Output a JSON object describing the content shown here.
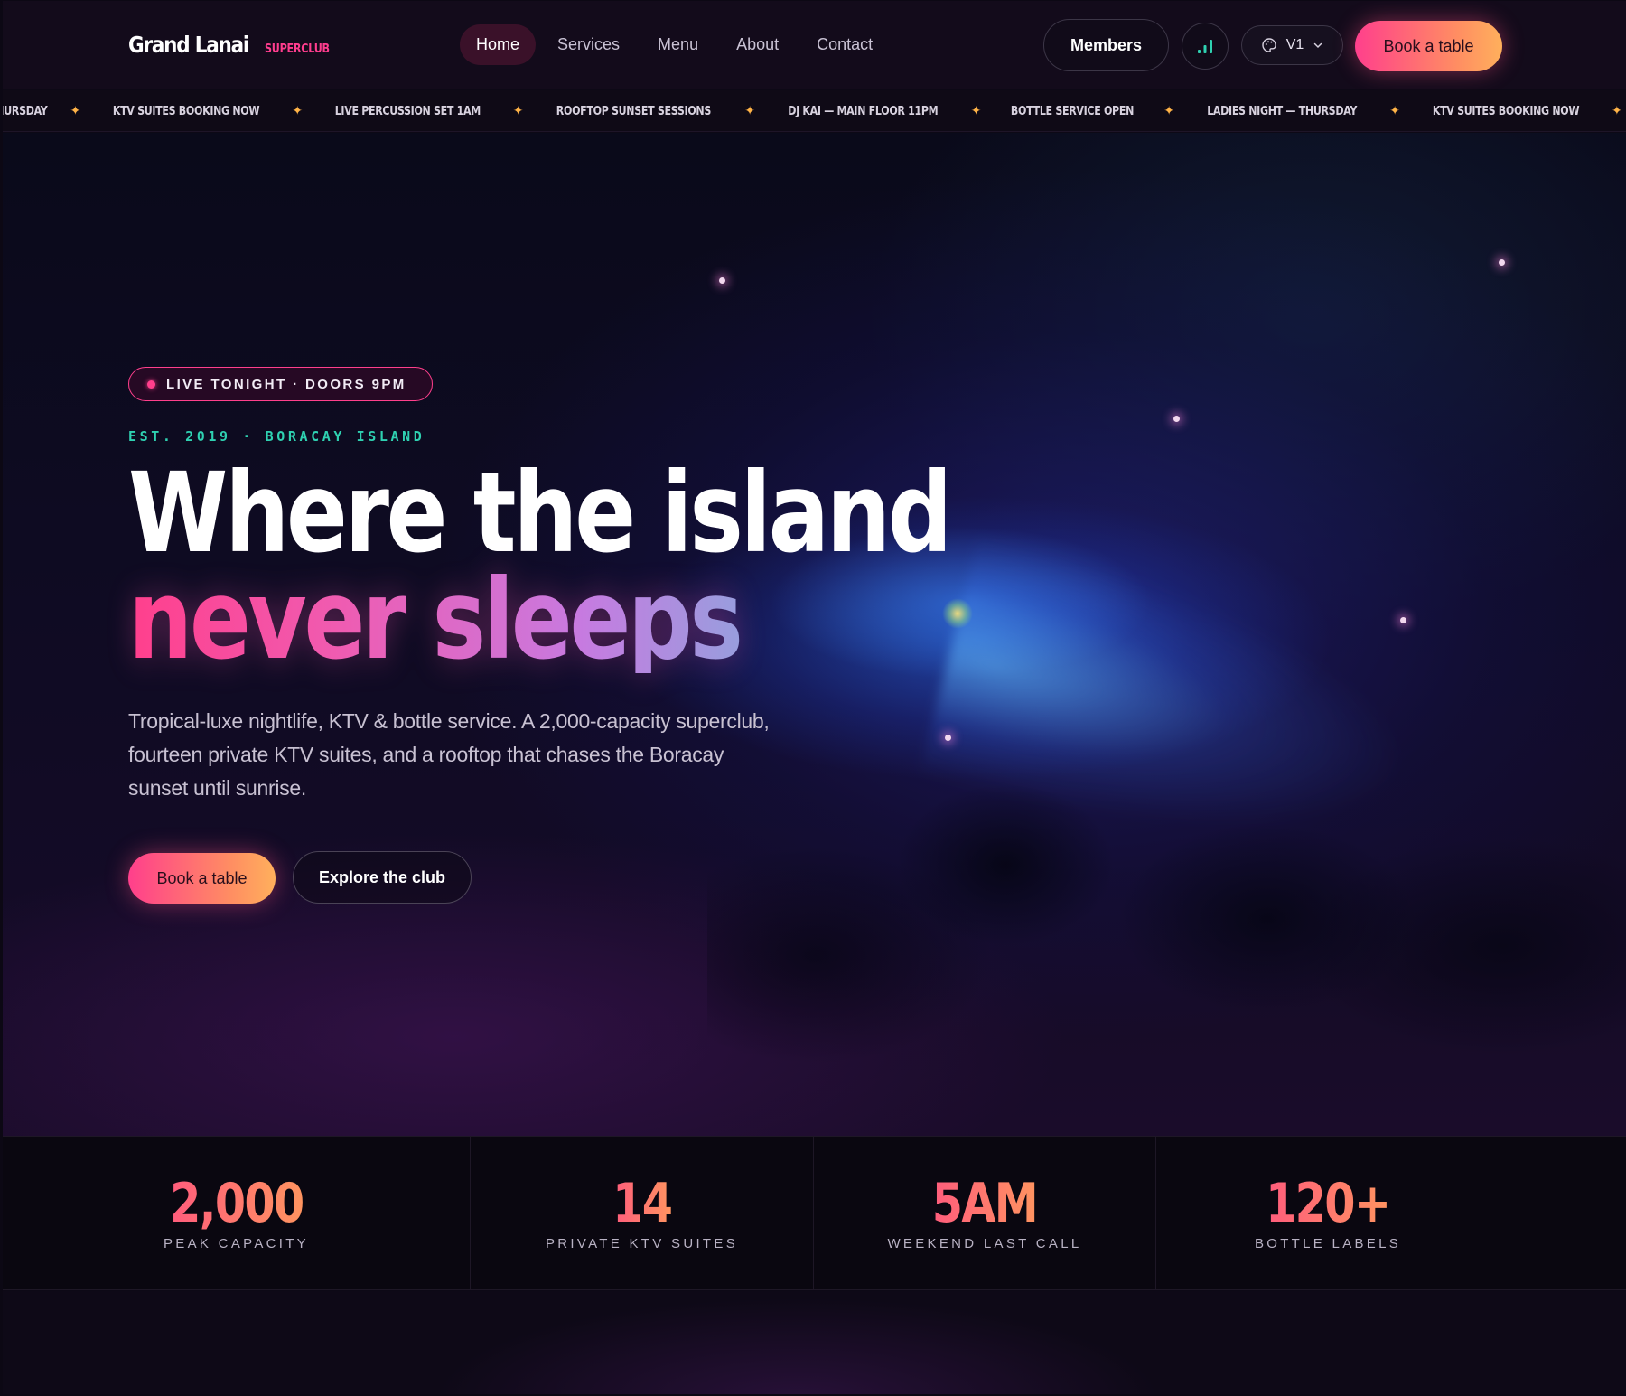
{
  "brand": {
    "name": "Grand Lanai",
    "tagline": "SUPERCLUB"
  },
  "nav": {
    "links": [
      "Home",
      "Services",
      "Menu",
      "About",
      "Contact"
    ],
    "active": "Home",
    "members_label": "Members",
    "theme_label": "V1",
    "book_label": "Book a table"
  },
  "ticker": {
    "items": [
      "THURSDAY",
      "KTV SUITES BOOKING NOW",
      "LIVE PERCUSSION SET 1AM",
      "ROOFTOP SUNSET SESSIONS",
      "DJ KAI — MAIN FLOOR 11PM",
      "BOTTLE SERVICE OPEN",
      "LADIES NIGHT — THURSDAY",
      "KTV SUITES BOOKING NOW"
    ],
    "separator": "✦"
  },
  "hero": {
    "badge": "LIVE TONIGHT · DOORS 9PM",
    "eyebrow": "EST. 2019 · BORACAY ISLAND",
    "headline_line1": "Where the island",
    "headline_line2": "never sleeps",
    "lede": "Tropical-luxe nightlife, KTV & bottle service. A 2,000-capacity superclub, fourteen private KTV suites, and a rooftop that chases the Boracay sunset until sunrise.",
    "primary_cta": "Book a table",
    "secondary_cta": "Explore the club"
  },
  "stats": [
    {
      "value": "2,000",
      "label": "PEAK CAPACITY"
    },
    {
      "value": "14",
      "label": "PRIVATE KTV SUITES"
    },
    {
      "value": "5AM",
      "label": "WEEKEND LAST CALL"
    },
    {
      "value": "120+",
      "label": "BOTTLE LABELS"
    }
  ],
  "colors": {
    "accent_pink": "#ff3f8c",
    "accent_orange": "#ff9460",
    "accent_teal": "#2fd1b1",
    "ticker_star": "#ffb347",
    "background": "#0d0916"
  },
  "icons": {
    "stats_button": "bar-chart-icon",
    "theme_button": "palette-icon",
    "theme_dropdown": "chevron-down-icon",
    "live": "live-dot-icon"
  }
}
